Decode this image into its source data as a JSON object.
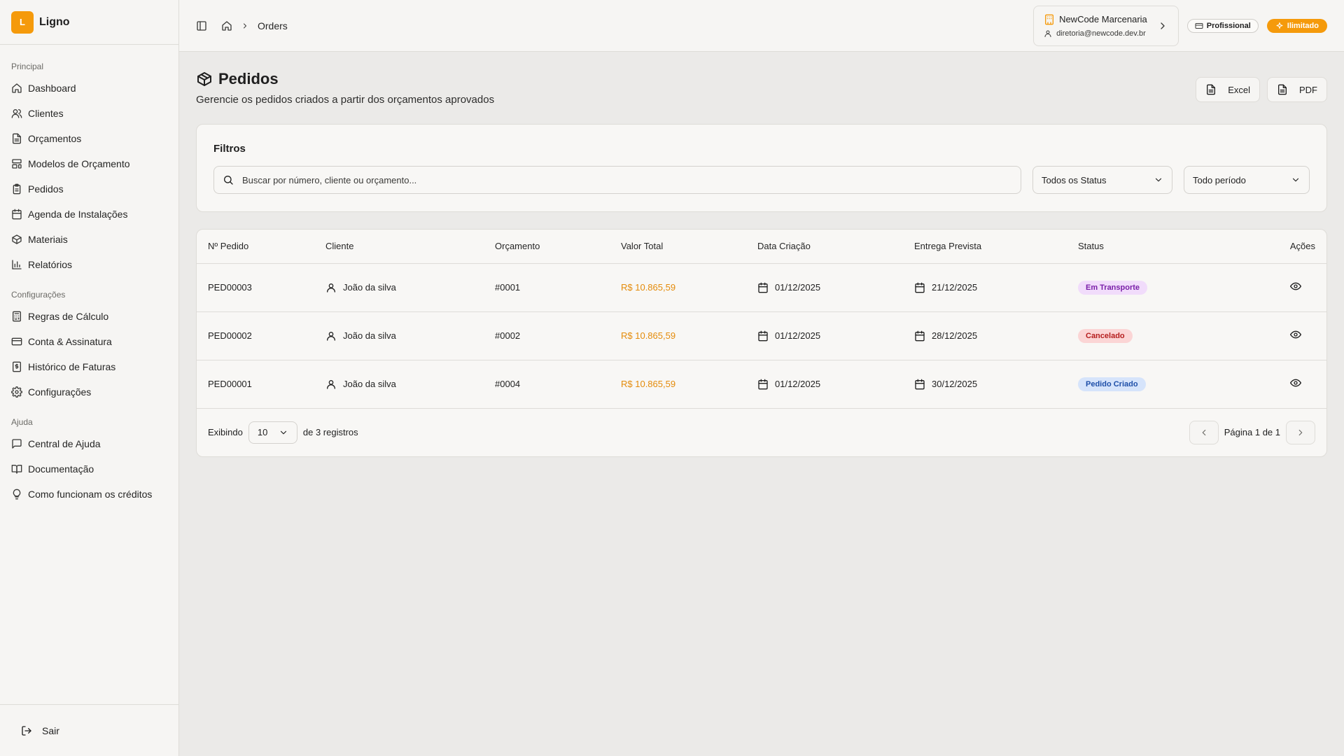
{
  "brand": {
    "initial": "L",
    "name": "Ligno",
    "accent": "#f59a0b"
  },
  "sidebar": {
    "groups": [
      {
        "label": "Principal",
        "items": [
          {
            "label": "Dashboard",
            "icon": "home-icon"
          },
          {
            "label": "Clientes",
            "icon": "users-icon"
          },
          {
            "label": "Orçamentos",
            "icon": "file-text-icon"
          },
          {
            "label": "Modelos de Orçamento",
            "icon": "layout-template-icon"
          },
          {
            "label": "Pedidos",
            "icon": "clipboard-icon"
          },
          {
            "label": "Agenda de Instalações",
            "icon": "calendar-icon"
          },
          {
            "label": "Materiais",
            "icon": "package-icon"
          },
          {
            "label": "Relatórios",
            "icon": "bar-chart-icon"
          }
        ]
      },
      {
        "label": "Configurações",
        "items": [
          {
            "label": "Regras de Cálculo",
            "icon": "calculator-icon"
          },
          {
            "label": "Conta & Assinatura",
            "icon": "credit-card-icon"
          },
          {
            "label": "Histórico de Faturas",
            "icon": "receipt-icon"
          },
          {
            "label": "Configurações",
            "icon": "gear-icon"
          }
        ]
      },
      {
        "label": "Ajuda",
        "items": [
          {
            "label": "Central de Ajuda",
            "icon": "message-square-icon"
          },
          {
            "label": "Documentação",
            "icon": "book-open-icon"
          },
          {
            "label": "Como funcionam os créditos",
            "icon": "lightbulb-icon"
          }
        ]
      }
    ],
    "logout_label": "Sair"
  },
  "header": {
    "breadcrumb_current": "Orders",
    "org_name": "NewCode Marcenaria",
    "org_email": "diretoria@newcode.dev.br",
    "plan_badge": "Profissional",
    "credits_badge": "Ilimitado"
  },
  "page": {
    "title": "Pedidos",
    "subtitle": "Gerencie os pedidos criados a partir dos orçamentos aprovados",
    "excel_label": "Excel",
    "pdf_label": "PDF"
  },
  "filters": {
    "title": "Filtros",
    "search_placeholder": "Buscar por número, cliente ou orçamento...",
    "status_selected": "Todos os Status",
    "period_selected": "Todo período"
  },
  "table": {
    "columns": [
      "Nº Pedido",
      "Cliente",
      "Orçamento",
      "Valor Total",
      "Data Criação",
      "Entrega Prevista",
      "Status",
      "Ações"
    ],
    "rows": [
      {
        "id": "PED00003",
        "client": "João da silva",
        "quote": "#0001",
        "total": "R$ 10.865,59",
        "created": "01/12/2025",
        "delivery": "21/12/2025",
        "status": "Em Transporte",
        "status_bg": "#f1dcfb",
        "status_fg": "#7a1fa8"
      },
      {
        "id": "PED00002",
        "client": "João da silva",
        "quote": "#0002",
        "total": "R$ 10.865,59",
        "created": "01/12/2025",
        "delivery": "28/12/2025",
        "status": "Cancelado",
        "status_bg": "#fbd5d5",
        "status_fg": "#b51d1d"
      },
      {
        "id": "PED00001",
        "client": "João da silva",
        "quote": "#0004",
        "total": "R$ 10.865,59",
        "created": "01/12/2025",
        "delivery": "30/12/2025",
        "status": "Pedido Criado",
        "status_bg": "#d6e4fb",
        "status_fg": "#1e4fa8"
      }
    ]
  },
  "pagination": {
    "showing_label": "Exibindo",
    "per_page": "10",
    "records_label": "de 3 registros",
    "page_label": "Página 1 de 1"
  }
}
